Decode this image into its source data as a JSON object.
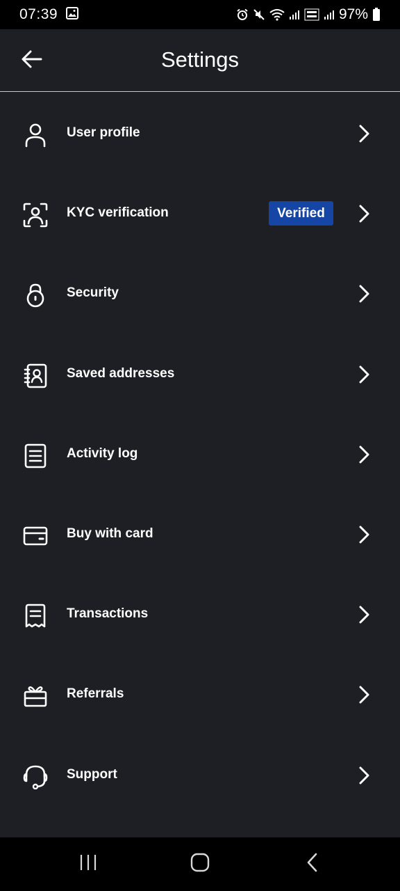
{
  "status_bar": {
    "time": "07:39",
    "battery_percent": "97%",
    "icons": [
      "image-icon",
      "alarm-icon",
      "mute-icon",
      "wifi-icon",
      "signal-icon",
      "volte-icon",
      "signal-icon",
      "battery-icon"
    ]
  },
  "header": {
    "title": "Settings",
    "back_icon": "arrow-left-icon"
  },
  "settings": {
    "items": [
      {
        "label": "User profile",
        "icon": "user-icon"
      },
      {
        "label": "KYC verification",
        "icon": "face-scan-icon",
        "badge": "Verified"
      },
      {
        "label": "Security",
        "icon": "lock-icon"
      },
      {
        "label": "Saved addresses",
        "icon": "contacts-book-icon"
      },
      {
        "label": "Activity log",
        "icon": "document-list-icon"
      },
      {
        "label": "Buy with card",
        "icon": "credit-card-icon"
      },
      {
        "label": "Transactions",
        "icon": "receipt-icon"
      },
      {
        "label": "Referrals",
        "icon": "gift-icon"
      },
      {
        "label": "Support",
        "icon": "headset-icon"
      }
    ]
  },
  "navigation_bar": {
    "buttons": [
      "recent-apps-icon",
      "home-icon",
      "back-icon"
    ]
  },
  "colors": {
    "background": "#1e1f24",
    "badge_background": "#1546a6",
    "text": "#ffffff"
  }
}
